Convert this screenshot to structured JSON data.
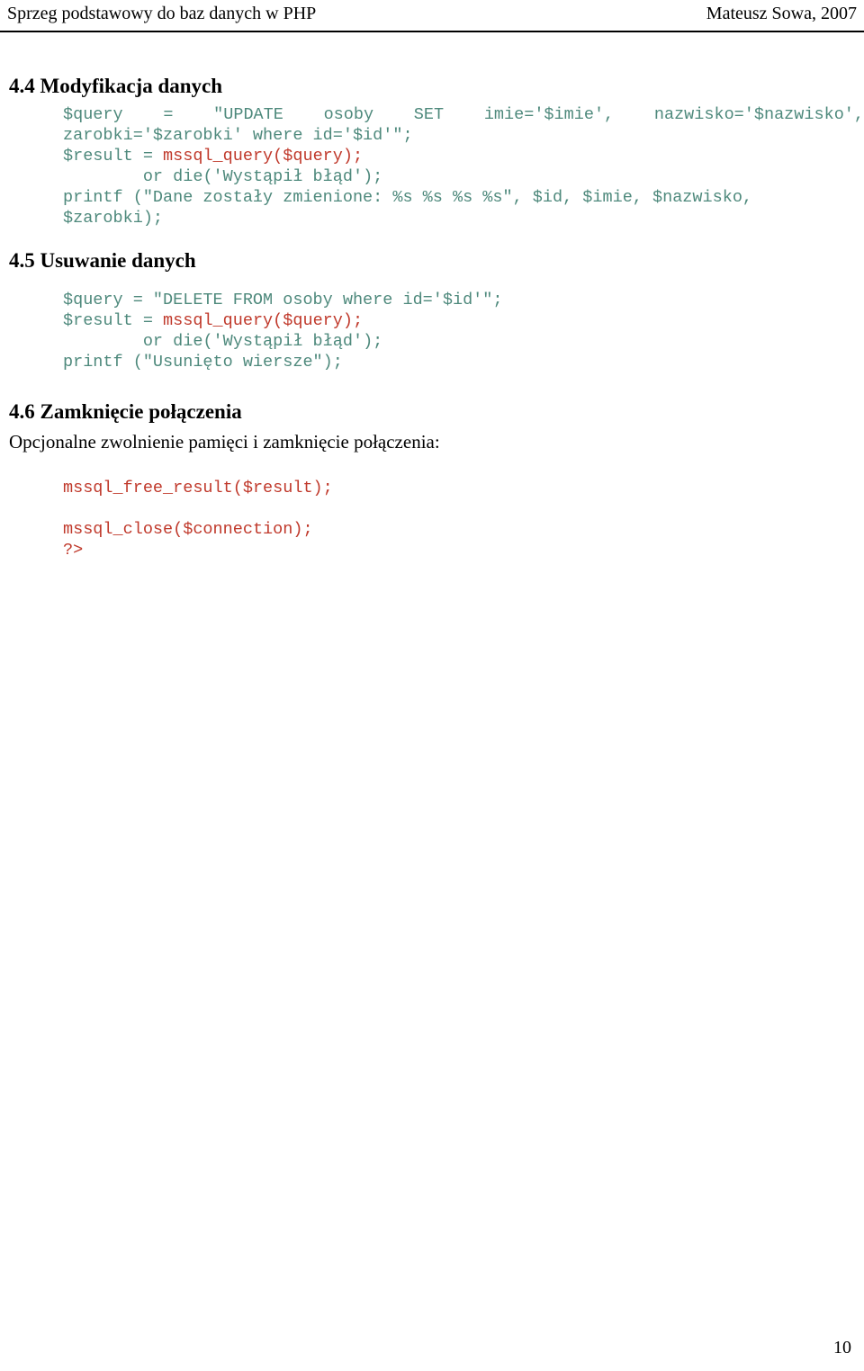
{
  "header": {
    "left_title": "Sprzeg podstawowy do baz danych w PHP",
    "right_author": "Mateusz Sowa, 2007"
  },
  "colors": {
    "code_default": "#4e897c",
    "code_function": "#c0392b",
    "text": "#000000",
    "background": "#ffffff",
    "rule": "#000000"
  },
  "sections": [
    {
      "number": "4.4",
      "heading": "4.4 Modyfikacja danych",
      "code": {
        "line1_justified": "$query = \"UPDATE osoby SET imie='$imie', nazwisko='$nazwisko',",
        "line2": "zarobki='$zarobki' where id='$id'\";",
        "line3_a": "$result = ",
        "line3_b": "mssql_query",
        "line3_c": "($query);",
        "line4": "        or die('Wystąpił błąd');",
        "line5": "printf (\"Dane zostały zmienione: %s %s %s %s\", $id, $imie, $nazwisko,",
        "line6": "$zarobki);"
      }
    },
    {
      "number": "4.5",
      "heading": "4.5 Usuwanie danych",
      "code": {
        "line1": "$query = \"DELETE FROM osoby where id='$id'\";",
        "line2_a": "$result = ",
        "line2_b": "mssql_query",
        "line2_c": "($query);",
        "line3": "        or die('Wystąpił błąd');",
        "line4": "printf (\"Usunięto wiersze\");"
      }
    },
    {
      "number": "4.6",
      "heading": "4.6 Zamknięcie połączenia",
      "prose": "Opcjonalne zwolnienie pamięci i zamknięcie połączenia:",
      "code": {
        "line1_a": "mssql_free_result",
        "line1_b": "($result);",
        "line2_a": "mssql_close",
        "line2_b": "($connection);",
        "line3": "?>"
      }
    }
  ],
  "footer": {
    "page_number": "10"
  }
}
